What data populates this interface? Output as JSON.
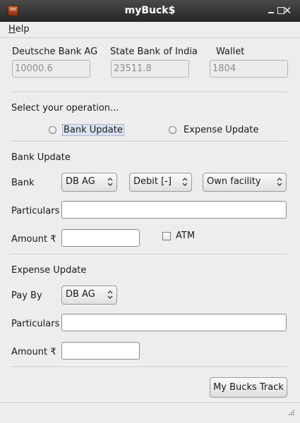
{
  "window": {
    "title": "myBuck$"
  },
  "menu": {
    "help_first": "H",
    "help_rest": "elp"
  },
  "balances": [
    {
      "label": "Deutsche Bank AG",
      "value": "10000.6"
    },
    {
      "label": "State Bank of India",
      "value": "23511.8"
    },
    {
      "label": "Wallet",
      "value": "1804"
    }
  ],
  "operation": {
    "prompt": "Select your operation...",
    "options": [
      "Bank Update",
      "Expense Update"
    ]
  },
  "bank_update": {
    "heading": "Bank Update",
    "bank_label": "Bank",
    "bank_value": "DB AG",
    "type_value": "Debit [-]",
    "facility_value": "Own facility",
    "particulars_label": "Particulars",
    "particulars_value": "",
    "amount_label": "Amount ₹",
    "amount_value": "",
    "atm_label": "ATM"
  },
  "expense_update": {
    "heading": "Expense Update",
    "payby_label": "Pay By",
    "payby_value": "DB AG",
    "particulars_label": "Particulars",
    "particulars_value": "",
    "amount_label": "Amount ₹",
    "amount_value": ""
  },
  "footer": {
    "track_button": "My Bucks Track"
  }
}
